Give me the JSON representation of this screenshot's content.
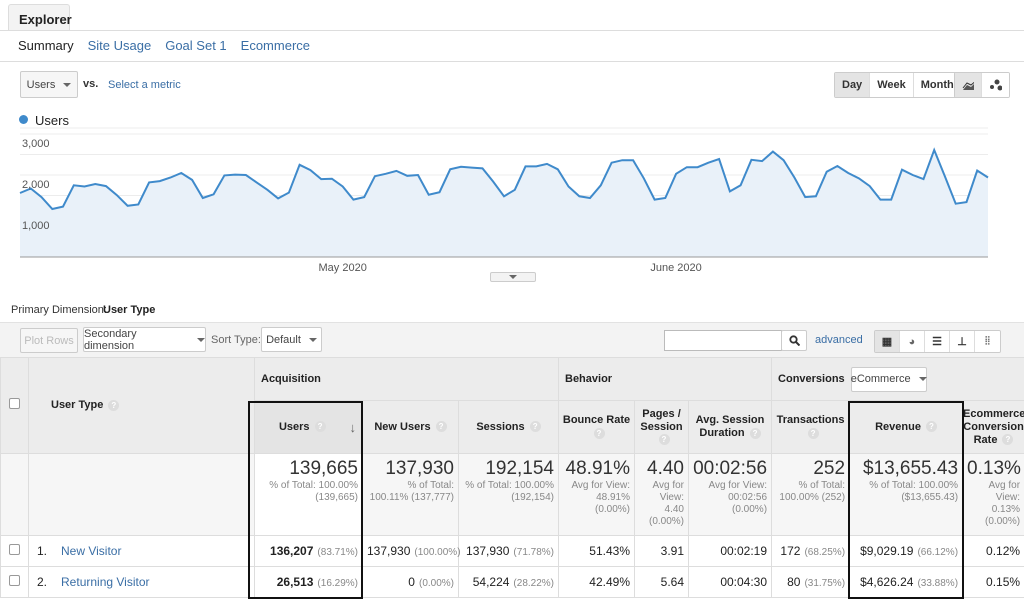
{
  "tab": "Explorer",
  "subnav": [
    "Summary",
    "Site Usage",
    "Goal Set 1",
    "Ecommerce"
  ],
  "metric_select": "Users",
  "vs": "vs.",
  "select_metric": "Select a metric",
  "granularity": [
    "Day",
    "Week",
    "Month"
  ],
  "granularity_selected": "Day",
  "chart_type_icons": [
    "line-chart-icon",
    "motion-chart-icon"
  ],
  "legend": "Users",
  "colors": {
    "line": "#3f8acb",
    "fill": "#e9f1f9",
    "link": "#3a6ea5"
  },
  "chart_data": {
    "type": "area",
    "series": [
      {
        "name": "Users",
        "values": [
          1560,
          1670,
          1460,
          1170,
          1230,
          1750,
          1720,
          1780,
          1730,
          1510,
          1250,
          1280,
          1820,
          1850,
          1940,
          2050,
          1880,
          1440,
          1530,
          1990,
          2010,
          2000,
          1820,
          1640,
          1430,
          1570,
          2250,
          2120,
          1900,
          1910,
          1720,
          1400,
          1460,
          1970,
          2030,
          2100,
          1980,
          2000,
          1520,
          1580,
          2140,
          2200,
          2180,
          2160,
          1840,
          1480,
          1640,
          2210,
          2210,
          2270,
          2140,
          1720,
          1480,
          1440,
          1750,
          2300,
          2360,
          2360,
          1920,
          1400,
          1440,
          2030,
          2190,
          2190,
          2300,
          2390,
          1600,
          1750,
          2370,
          2340,
          2570,
          2360,
          1940,
          1460,
          1480,
          2080,
          2220,
          2050,
          1920,
          1730,
          1400,
          1400,
          2130,
          2000,
          1900,
          2610,
          1960,
          1300,
          1340,
          2110,
          1940
        ]
      }
    ],
    "x_start": "2020-04-01",
    "x_end": "2020-07-01",
    "x_tick_labels": [
      "May 2020",
      "June 2020"
    ],
    "y_tick_labels": [
      "3,000",
      "2,000",
      "1,000"
    ],
    "ylim": [
      0,
      3000
    ],
    "grid": true
  },
  "primary_dimension_label": "Primary Dimension:",
  "primary_dimension": "User Type",
  "toolbar": {
    "plot_rows": "Plot Rows",
    "secondary": "Secondary dimension",
    "sort_label": "Sort Type:",
    "sort_value": "Default",
    "search_placeholder": "",
    "advanced": "advanced",
    "view_icons": [
      "grid-view-icon",
      "pie-view-icon",
      "bar-view-icon",
      "comparison-view-icon",
      "pivot-view-icon"
    ]
  },
  "table": {
    "dim_header": "User Type",
    "groups": [
      "Acquisition",
      "Behavior",
      "Conversions"
    ],
    "conversions_select": "eCommerce",
    "columns": [
      "Users",
      "New Users",
      "Sessions",
      "Bounce Rate",
      "Pages / Session",
      "Avg. Session Duration",
      "Transactions",
      "Revenue",
      "Ecommerce Conversion Rate"
    ],
    "totals": [
      {
        "v": "139,665",
        "s": "% of Total: 100.00% (139,665)"
      },
      {
        "v": "137,930",
        "s": "% of Total: 100.11% (137,777)"
      },
      {
        "v": "192,154",
        "s": "% of Total: 100.00% (192,154)"
      },
      {
        "v": "48.91%",
        "s": "Avg for View: 48.91% (0.00%)"
      },
      {
        "v": "4.40",
        "s": "Avg for View: 4.40 (0.00%)"
      },
      {
        "v": "00:02:56",
        "s": "Avg for View: 00:02:56 (0.00%)"
      },
      {
        "v": "252",
        "s": "% of Total: 100.00% (252)"
      },
      {
        "v": "$13,655.43",
        "s": "% of Total: 100.00% ($13,655.43)"
      },
      {
        "v": "0.13%",
        "s": "Avg for View: 0.13% (0.00%)"
      }
    ],
    "rows": [
      {
        "n": "1.",
        "name": "New Visitor",
        "cells": [
          [
            "136,207",
            "(83.71%)"
          ],
          [
            "137,930",
            "(100.00%)"
          ],
          [
            "137,930",
            "(71.78%)"
          ],
          [
            "51.43%",
            ""
          ],
          [
            "3.91",
            ""
          ],
          [
            "00:02:19",
            ""
          ],
          [
            "172",
            "(68.25%)"
          ],
          [
            "$9,029.19",
            "(66.12%)"
          ],
          [
            "0.12%",
            ""
          ]
        ]
      },
      {
        "n": "2.",
        "name": "Returning Visitor",
        "cells": [
          [
            "26,513",
            "(16.29%)"
          ],
          [
            "0",
            "(0.00%)"
          ],
          [
            "54,224",
            "(28.22%)"
          ],
          [
            "42.49%",
            ""
          ],
          [
            "5.64",
            ""
          ],
          [
            "00:04:30",
            ""
          ],
          [
            "80",
            "(31.75%)"
          ],
          [
            "$4,626.24",
            "(33.88%)"
          ],
          [
            "0.15%",
            ""
          ]
        ]
      }
    ]
  }
}
